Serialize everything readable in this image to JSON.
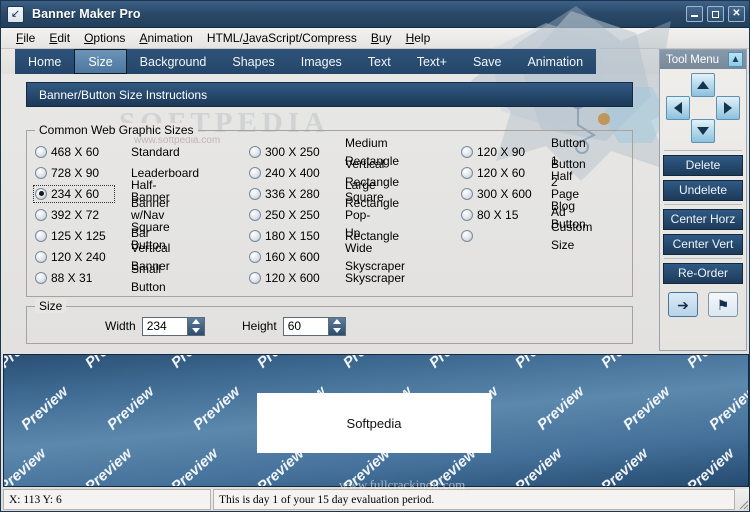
{
  "window": {
    "title": "Banner Maker Pro",
    "app_icon": "app-icon",
    "minimize_label": "–",
    "maximize_label": "□",
    "close_label": "✕"
  },
  "menubar": {
    "items": [
      {
        "label": "File",
        "accel": "F"
      },
      {
        "label": "Edit",
        "accel": "E"
      },
      {
        "label": "Options",
        "accel": "O"
      },
      {
        "label": "Animation",
        "accel": "A"
      },
      {
        "label": "HTML/JavaScript/Compress",
        "accel": "J"
      },
      {
        "label": "Buy",
        "accel": "B"
      },
      {
        "label": "Help",
        "accel": "H"
      }
    ]
  },
  "tabs": [
    {
      "label": "Home",
      "active": false
    },
    {
      "label": "Size",
      "active": true
    },
    {
      "label": "Background",
      "active": false
    },
    {
      "label": "Shapes",
      "active": false
    },
    {
      "label": "Images",
      "active": false
    },
    {
      "label": "Text",
      "active": false
    },
    {
      "label": "Text+",
      "active": false
    },
    {
      "label": "Save",
      "active": false
    },
    {
      "label": "Animation",
      "active": false
    }
  ],
  "watermarks": {
    "softpedia_big": "SOFTPEDIA",
    "softpedia_url": "www.softpedia.com",
    "preview_word": "Preview",
    "bottom_url": "www.fullcrackindir.com"
  },
  "instructions_bar": {
    "label": "Banner/Button Size Instructions",
    "chevron": "»"
  },
  "sizes_group": {
    "title": "Common Web Graphic Sizes",
    "columns": [
      {
        "options": [
          {
            "size": "468 X 60",
            "desc": "Standard",
            "selected": false
          },
          {
            "size": "728 X 90",
            "desc": "Leaderboard",
            "selected": false
          },
          {
            "size": "234 X 60",
            "desc": "Half-Banner",
            "selected": true
          },
          {
            "size": "392 X 72",
            "desc": "Banner w/Nav Bar",
            "selected": false
          },
          {
            "size": "125 X 125",
            "desc": "Square Button",
            "selected": false
          },
          {
            "size": "120 X 240",
            "desc": "Vertical Banner",
            "selected": false
          },
          {
            "size": "88 X 31",
            "desc": "Small Button",
            "selected": false
          }
        ]
      },
      {
        "options": [
          {
            "size": "300 X 250",
            "desc": "Medium Rectangle",
            "selected": false
          },
          {
            "size": "240 X 400",
            "desc": "Vertical Rectangle",
            "selected": false
          },
          {
            "size": "336 X 280",
            "desc": "Large Rectangle",
            "selected": false
          },
          {
            "size": "250 X 250",
            "desc": "Square Pop-Up",
            "selected": false
          },
          {
            "size": "180 X 150",
            "desc": "Rectangle",
            "selected": false
          },
          {
            "size": "160 X 600",
            "desc": "Wide Skyscraper",
            "selected": false
          },
          {
            "size": "120 X 600",
            "desc": "Skyscraper",
            "selected": false
          }
        ]
      },
      {
        "options": [
          {
            "size": "120 X 90",
            "desc": "Button 1",
            "selected": false
          },
          {
            "size": "120 X 60",
            "desc": "Button 2",
            "selected": false
          },
          {
            "size": "300 X 600",
            "desc": "Half Page Ad",
            "selected": false
          },
          {
            "size": "80 X  15",
            "desc": "Blog Button",
            "selected": false
          },
          {
            "size": "",
            "desc": "Custom Size",
            "selected": false
          }
        ]
      }
    ]
  },
  "size_group": {
    "title": "Size",
    "width_label": "Width",
    "width_value": "234",
    "height_label": "Height",
    "height_value": "60"
  },
  "tool_menu": {
    "title": "Tool Menu",
    "collapse_icon": "«",
    "nudge": {
      "up": "move-up",
      "down": "move-down",
      "left": "move-left",
      "right": "move-right"
    },
    "buttons": [
      {
        "label": "Delete"
      },
      {
        "label": "Undelete"
      },
      {
        "label": "Center Horz"
      },
      {
        "label": "Center Vert"
      },
      {
        "label": "Re-Order"
      }
    ],
    "small_buttons": [
      {
        "icon": "arrow-right-icon",
        "glyph": "➔",
        "selected": true
      },
      {
        "icon": "flag-icon",
        "glyph": "⚑",
        "selected": false
      }
    ]
  },
  "preview": {
    "banner_text": "Softpedia",
    "banner_width": 234,
    "banner_height": 60
  },
  "statusbar": {
    "coords": "X: 113  Y: 6",
    "message": "This is day 1 of your 15 day evaluation period."
  },
  "colors": {
    "titlebar": "#2b4a69",
    "tab_active": "#5d88ad",
    "tab_strip": "#27496c",
    "panel_bg": "#e7e6e3",
    "preview_bg": "#44719a",
    "button_blue": "#27496c"
  }
}
